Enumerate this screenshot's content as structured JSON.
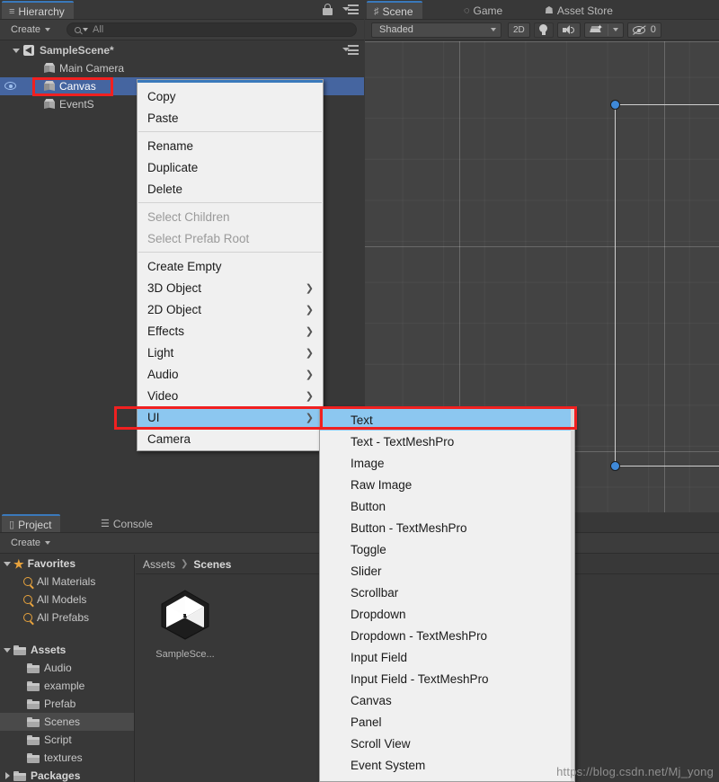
{
  "hierarchy": {
    "tabs": [
      {
        "label": "Hierarchy",
        "icon": "hierarchy-icon",
        "active": true
      }
    ],
    "toolbar": {
      "create_label": "Create",
      "search_placeholder": "All",
      "search_value": ""
    },
    "rows": [
      {
        "label": "SampleScene*",
        "icon": "scene-icon",
        "indent": 14,
        "foldout": "open",
        "bold": true,
        "selected": false,
        "eye": false
      },
      {
        "label": "Main Camera",
        "icon": "cube-icon",
        "indent": 48,
        "foldout": "none",
        "bold": false,
        "selected": false,
        "eye": false
      },
      {
        "label": "Canvas",
        "icon": "cube-icon",
        "indent": 48,
        "foldout": "none",
        "bold": false,
        "selected": true,
        "eye": true
      },
      {
        "label": "EventS",
        "icon": "cube-icon",
        "indent": 48,
        "foldout": "none",
        "bold": false,
        "selected": false,
        "eye": false
      }
    ]
  },
  "scene": {
    "tabs": [
      {
        "label": "Scene",
        "icon": "grid-icon",
        "active": true
      },
      {
        "label": "Game",
        "icon": "gamepad-icon",
        "active": false
      },
      {
        "label": "Asset Store",
        "icon": "store-icon",
        "active": false
      }
    ],
    "toolbar": {
      "shading_mode": "Shaded",
      "toggle_2d": "2D",
      "lighting_icon": "lightbulb-icon",
      "audio_icon": "speaker-icon",
      "effects_icon": "effects-icon",
      "gizmos_icon": "eye-off-icon",
      "gizmos_count": "0"
    }
  },
  "context_menu": {
    "items": [
      {
        "label": "Copy",
        "submenu": false,
        "disabled": false,
        "highlight": false
      },
      {
        "label": "Paste",
        "submenu": false,
        "disabled": false,
        "highlight": false
      },
      {
        "separator": true
      },
      {
        "label": "Rename",
        "submenu": false,
        "disabled": false,
        "highlight": false
      },
      {
        "label": "Duplicate",
        "submenu": false,
        "disabled": false,
        "highlight": false
      },
      {
        "label": "Delete",
        "submenu": false,
        "disabled": false,
        "highlight": false
      },
      {
        "separator": true
      },
      {
        "label": "Select Children",
        "submenu": false,
        "disabled": true,
        "highlight": false
      },
      {
        "label": "Select Prefab Root",
        "submenu": false,
        "disabled": true,
        "highlight": false
      },
      {
        "separator": true
      },
      {
        "label": "Create Empty",
        "submenu": false,
        "disabled": false,
        "highlight": false
      },
      {
        "label": "3D Object",
        "submenu": true,
        "disabled": false,
        "highlight": false
      },
      {
        "label": "2D Object",
        "submenu": true,
        "disabled": false,
        "highlight": false
      },
      {
        "label": "Effects",
        "submenu": true,
        "disabled": false,
        "highlight": false
      },
      {
        "label": "Light",
        "submenu": true,
        "disabled": false,
        "highlight": false
      },
      {
        "label": "Audio",
        "submenu": true,
        "disabled": false,
        "highlight": false
      },
      {
        "label": "Video",
        "submenu": true,
        "disabled": false,
        "highlight": false
      },
      {
        "label": "UI",
        "submenu": true,
        "disabled": false,
        "highlight": true
      },
      {
        "label": "Camera",
        "submenu": false,
        "disabled": false,
        "highlight": false
      }
    ]
  },
  "submenu": {
    "items": [
      {
        "label": "Text",
        "highlight": true
      },
      {
        "label": "Text - TextMeshPro",
        "highlight": false
      },
      {
        "label": "Image",
        "highlight": false
      },
      {
        "label": "Raw Image",
        "highlight": false
      },
      {
        "label": "Button",
        "highlight": false
      },
      {
        "label": "Button - TextMeshPro",
        "highlight": false
      },
      {
        "label": "Toggle",
        "highlight": false
      },
      {
        "label": "Slider",
        "highlight": false
      },
      {
        "label": "Scrollbar",
        "highlight": false
      },
      {
        "label": "Dropdown",
        "highlight": false
      },
      {
        "label": "Dropdown - TextMeshPro",
        "highlight": false
      },
      {
        "label": "Input Field",
        "highlight": false
      },
      {
        "label": "Input Field - TextMeshPro",
        "highlight": false
      },
      {
        "label": "Canvas",
        "highlight": false
      },
      {
        "label": "Panel",
        "highlight": false
      },
      {
        "label": "Scroll View",
        "highlight": false
      },
      {
        "label": "Event System",
        "highlight": false
      }
    ]
  },
  "project": {
    "tabs": [
      {
        "label": "Project",
        "icon": "folder-icon",
        "active": true
      },
      {
        "label": "Console",
        "icon": "console-icon",
        "active": false
      }
    ],
    "toolbar": {
      "create_label": "Create"
    },
    "tree": [
      {
        "label": "Favorites",
        "icon": "star-icon",
        "indent": 4,
        "foldout": "open",
        "bold": true,
        "selected": false
      },
      {
        "label": "All Materials",
        "icon": "search-icon",
        "indent": 22,
        "foldout": "none",
        "bold": false,
        "selected": false
      },
      {
        "label": "All Models",
        "icon": "search-icon",
        "indent": 22,
        "foldout": "none",
        "bold": false,
        "selected": false
      },
      {
        "label": "All Prefabs",
        "icon": "search-icon",
        "indent": 22,
        "foldout": "none",
        "bold": false,
        "selected": false
      },
      {
        "spacer": true
      },
      {
        "label": "Assets",
        "icon": "folder-icon",
        "indent": 4,
        "foldout": "open",
        "bold": true,
        "selected": false
      },
      {
        "label": "Audio",
        "icon": "folder-icon",
        "indent": 26,
        "foldout": "none",
        "bold": false,
        "selected": false
      },
      {
        "label": "example",
        "icon": "folder-icon",
        "indent": 26,
        "foldout": "none",
        "bold": false,
        "selected": false
      },
      {
        "label": "Prefab",
        "icon": "folder-icon",
        "indent": 26,
        "foldout": "none",
        "bold": false,
        "selected": false
      },
      {
        "label": "Scenes",
        "icon": "folder-icon",
        "indent": 26,
        "foldout": "none",
        "bold": false,
        "selected": true
      },
      {
        "label": "Script",
        "icon": "folder-icon",
        "indent": 26,
        "foldout": "none",
        "bold": false,
        "selected": false
      },
      {
        "label": "textures",
        "icon": "folder-icon",
        "indent": 26,
        "foldout": "none",
        "bold": false,
        "selected": false
      },
      {
        "label": "Packages",
        "icon": "folder-icon",
        "indent": 4,
        "foldout": "closed",
        "bold": true,
        "selected": false
      }
    ],
    "breadcrumb": {
      "root": "Assets",
      "separator": "❯",
      "current": "Scenes"
    },
    "assets": [
      {
        "label": "SampleSce...",
        "icon": "unity-scene-icon"
      }
    ]
  },
  "watermark": {
    "text": "https://blog.csdn.net/Mj_yong"
  },
  "colors": {
    "panel_bg": "#383838",
    "selection_blue": "#4565a0",
    "menu_bg": "#f0f0f0",
    "menu_highlight": "#8cc7f0",
    "annotation_red": "#f02020",
    "scene_bg": "#434343",
    "handle_blue": "#3f89d8",
    "favorite_gold": "#e8a33d"
  }
}
